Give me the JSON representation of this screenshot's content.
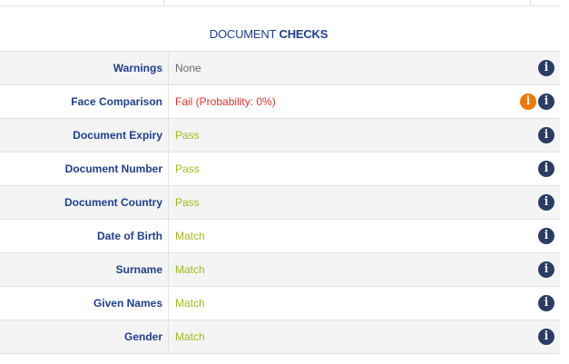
{
  "section": {
    "title_prefix": "DOCUMENT",
    "title_strong": "CHECKS"
  },
  "icons": {
    "info": "i",
    "info_icon_name": "info-circle-icon",
    "warning_icon_name": "warning-info-icon"
  },
  "colors": {
    "label": "#1f3f8f",
    "neutral": "#6b6b6b",
    "fail": "#e8322b",
    "pass": "#a6b81c",
    "info": "#2b3d63",
    "warning": "#f07800"
  },
  "rows": [
    {
      "label": "Warnings",
      "value": "None"
    },
    {
      "label": "Face Comparison",
      "value": "Fail (Probability: 0%)"
    },
    {
      "label": "Document Expiry",
      "value": "Pass"
    },
    {
      "label": "Document Number",
      "value": "Pass"
    },
    {
      "label": "Document Country",
      "value": "Pass"
    },
    {
      "label": "Date of Birth",
      "value": "Match"
    },
    {
      "label": "Surname",
      "value": "Match"
    },
    {
      "label": "Given Names",
      "value": "Match"
    },
    {
      "label": "Gender",
      "value": "Match"
    }
  ]
}
